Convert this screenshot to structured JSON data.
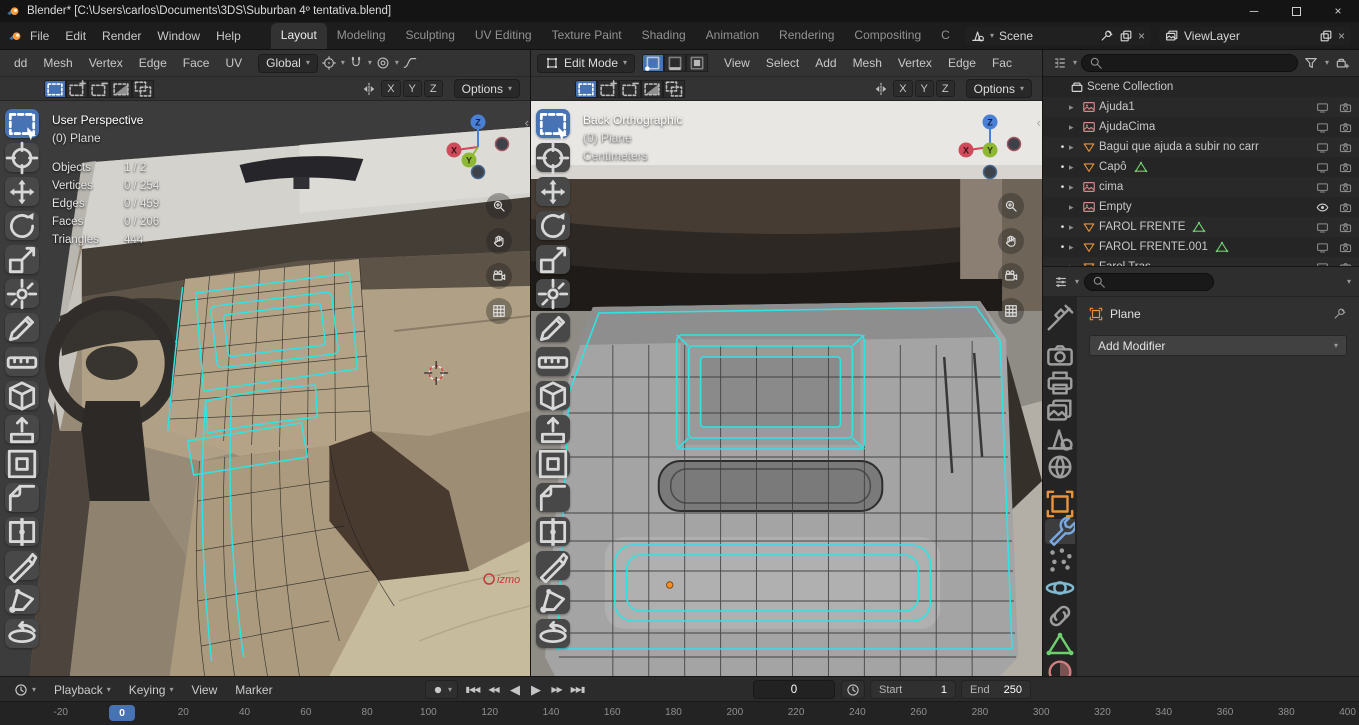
{
  "titlebar": {
    "title": "Blender* [C:\\Users\\carlos\\Documents\\3DS\\Suburban 4º tentativa.blend]",
    "minimize_label": "─",
    "close_label": "×"
  },
  "topbar": {
    "menus": [
      "File",
      "Edit",
      "Render",
      "Window",
      "Help"
    ],
    "workspaces": [
      "Layout",
      "Modeling",
      "Sculpting",
      "UV Editing",
      "Texture Paint",
      "Shading",
      "Animation",
      "Rendering",
      "Compositing",
      "C"
    ],
    "active_workspace": "Layout",
    "scene": {
      "label": "Scene"
    },
    "viewlayer": {
      "label": "ViewLayer"
    }
  },
  "viewports": {
    "select_modes": [
      "select-set",
      "select-extend",
      "select-subtract",
      "select-invert",
      "select-intersect"
    ],
    "tools": [
      "select-box",
      "cursor",
      "move",
      "rotate",
      "scale",
      "transform",
      "annotate",
      "measure",
      "add-cube",
      "extrude-region",
      "inset-faces",
      "bevel",
      "loop-cut",
      "knife",
      "poly-build",
      "spin"
    ],
    "active_tool": "select-box",
    "nav_buttons": [
      "zoom",
      "hand",
      "videocam",
      "grid"
    ],
    "mirror_axes": [
      "X",
      "Y",
      "Z"
    ],
    "axis_labels": {
      "x": "X",
      "y": "Y",
      "z": "Z"
    },
    "left": {
      "menu_items": [
        "dd",
        "Mesh",
        "Vertex",
        "Edge",
        "Face",
        "UV"
      ],
      "orientation": "Global",
      "options_label": "Options",
      "overlay_lines": [
        "User Perspective",
        "(0) Plane"
      ],
      "stats": [
        {
          "label": "Objects",
          "value": "1 / 2"
        },
        {
          "label": "Vertices",
          "value": "0 / 254"
        },
        {
          "label": "Edges",
          "value": "0 / 459"
        },
        {
          "label": "Faces",
          "value": "0 / 206"
        },
        {
          "label": "Triangles",
          "value": "444"
        }
      ],
      "watermark": "izmo"
    },
    "right": {
      "mode": "Edit Mode",
      "mesh_select_modes": [
        "vertex",
        "edge",
        "face"
      ],
      "menu_items": [
        "View",
        "Select",
        "Add",
        "Mesh",
        "Vertex",
        "Edge",
        "Fac"
      ],
      "options_label": "Options",
      "overlay_lines": [
        "Back Orthographic",
        "(0) Plane",
        "Centimeters"
      ]
    }
  },
  "outliner": {
    "root_label": "Scene Collection",
    "rows": [
      {
        "name": "Scene Collection",
        "icon": "collection",
        "level": 0,
        "arrow": false,
        "dot": false,
        "trailing": []
      },
      {
        "name": "Ajuda1",
        "icon": "image",
        "level": 1,
        "arrow": true,
        "dot": false,
        "trailing": [
          "screen",
          "camera"
        ]
      },
      {
        "name": "AjudaCima",
        "icon": "image",
        "level": 1,
        "arrow": true,
        "dot": false,
        "trailing": [
          "screen",
          "camera"
        ]
      },
      {
        "name": "Bagui que ajuda a subir no carr",
        "icon": "mesh-object",
        "level": 1,
        "arrow": true,
        "dot": true,
        "trailing": [
          "screen",
          "camera"
        ]
      },
      {
        "name": "Capô",
        "icon": "mesh-object",
        "data_icon": "mesh-data",
        "level": 1,
        "arrow": true,
        "dot": true,
        "trailing": [
          "screen",
          "camera"
        ]
      },
      {
        "name": "cima",
        "icon": "image",
        "level": 1,
        "arrow": true,
        "dot": true,
        "trailing": [
          "screen",
          "camera"
        ]
      },
      {
        "name": "Empty",
        "icon": "image",
        "level": 1,
        "arrow": true,
        "dot": false,
        "trailing": [
          "eye",
          "camera"
        ]
      },
      {
        "name": "FAROL FRENTE",
        "icon": "mesh-object",
        "data_icon": "mesh-data",
        "level": 1,
        "arrow": true,
        "dot": true,
        "trailing": [
          "screen",
          "camera"
        ]
      },
      {
        "name": "FAROL FRENTE.001",
        "icon": "mesh-object",
        "data_icon": "mesh-data",
        "level": 1,
        "arrow": true,
        "dot": true,
        "trailing": [
          "screen",
          "camera"
        ]
      },
      {
        "name": "Farol Tras",
        "icon": "mesh-object",
        "level": 1,
        "arrow": true,
        "dot": false,
        "trailing": [
          "screen",
          "camera"
        ]
      }
    ]
  },
  "properties": {
    "tabs": [
      "tool",
      "render",
      "output",
      "view-layer",
      "scene",
      "world",
      "object",
      "modifiers",
      "particles",
      "physics",
      "constraints",
      "data",
      "material"
    ],
    "active_tab": "modifiers",
    "breadcrumb": {
      "object": "Plane"
    },
    "add_modifier_label": "Add Modifier"
  },
  "timeline": {
    "menus": [
      {
        "label": "Playback",
        "dropdown": true
      },
      {
        "label": "Keying",
        "dropdown": true
      },
      {
        "label": "View",
        "dropdown": false
      },
      {
        "label": "Marker",
        "dropdown": false
      }
    ],
    "transport": [
      "jump-to-start",
      "prev-keyframe",
      "play-reverse",
      "play",
      "next-keyframe",
      "jump-to-end"
    ],
    "frame_current": "0",
    "start": {
      "label": "Start",
      "value": "1"
    },
    "end": {
      "label": "End",
      "value": "250"
    },
    "ruler": {
      "min": -20,
      "max": 400,
      "step": 20,
      "current": 0
    }
  },
  "colors": {
    "accent": "#4772b3",
    "edge_select": "#2fe3e3",
    "axis_x": "#cf4a5a",
    "axis_y": "#8fb832",
    "axis_z": "#4a7fd6",
    "object_orange": "#e8923c",
    "data_green": "#6fcf6f"
  }
}
